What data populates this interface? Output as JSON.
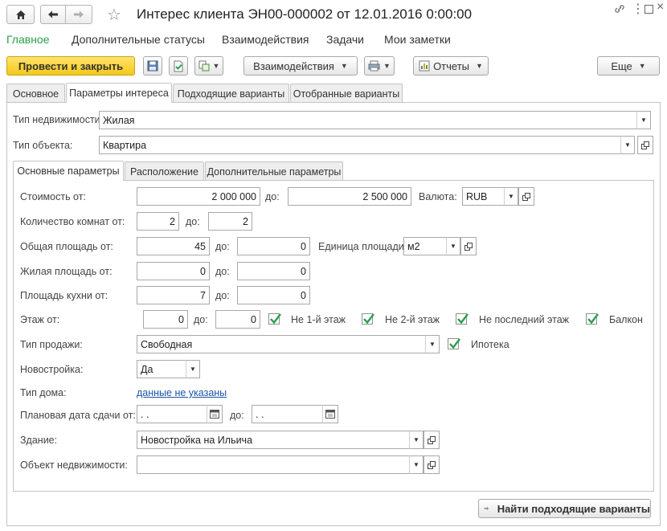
{
  "window": {
    "title": "Интерес клиента ЭН00-000002 от 12.01.2016 0:00:00"
  },
  "sections": [
    {
      "label": "Главное"
    },
    {
      "label": "Дополнительные статусы"
    },
    {
      "label": "Взаимодействия"
    },
    {
      "label": "Задачи"
    },
    {
      "label": "Мои заметки"
    }
  ],
  "toolbar": {
    "post_close_label": "Провести и закрыть",
    "interactions_label": "Взаимодействия",
    "reports_label": "Отчеты",
    "more_label": "Еще"
  },
  "tabs": [
    {
      "label": "Основное"
    },
    {
      "label": "Параметры интереса"
    },
    {
      "label": "Подходящие варианты"
    },
    {
      "label": "Отобранные варианты"
    }
  ],
  "top_fields": {
    "property_type_label": "Тип недвижимости:",
    "property_type_value": "Жилая",
    "object_type_label": "Тип объекта:",
    "object_type_value": "Квартира"
  },
  "subtabs": [
    {
      "label": "Основные параметры"
    },
    {
      "label": "Расположение"
    },
    {
      "label": "Дополнительные параметры"
    }
  ],
  "params": {
    "to_label": "до:",
    "cost_label": "Стоимость от:",
    "cost_from": "2 000 000",
    "cost_to": "2 500 000",
    "currency_label": "Валюта:",
    "currency_value": "RUB",
    "rooms_label": "Количество комнат от:",
    "rooms_from": "2",
    "rooms_to": "2",
    "total_area_label": "Общая площадь от:",
    "total_area_from": "45",
    "total_area_to": "0",
    "area_unit_label": "Единица площади:",
    "area_unit_value": "м2",
    "living_area_label": "Жилая площадь от:",
    "living_area_from": "0",
    "living_area_to": "0",
    "kitchen_area_label": "Площадь кухни от:",
    "kitchen_area_from": "7",
    "kitchen_area_to": "0",
    "floor_label": "Этаж от:",
    "floor_from": "0",
    "floor_to": "0",
    "not_first_floor_label": "Не 1-й этаж",
    "not_first_floor_checked": true,
    "not_second_floor_label": "Не 2-й этаж",
    "not_second_floor_checked": true,
    "not_last_floor_label": "Не последний этаж",
    "not_last_floor_checked": true,
    "balcony_label": "Балкон",
    "balcony_checked": true,
    "sale_type_label": "Тип продажи:",
    "sale_type_value": "Свободная",
    "mortgage_label": "Ипотека",
    "mortgage_checked": true,
    "new_building_label": "Новостройка:",
    "new_building_value": "Да",
    "house_type_label": "Тип дома:",
    "house_type_value": "данные не указаны",
    "planned_date_label": "Плановая дата сдачи от:",
    "planned_date_from": " .  .",
    "planned_date_to": " .  .",
    "building_label": "Здание:",
    "building_value": "Новостройка на Ильича",
    "real_estate_label": "Объект недвижимости:",
    "real_estate_value": ""
  },
  "footer": {
    "find_button_label": "Найти подходящие варианты"
  }
}
